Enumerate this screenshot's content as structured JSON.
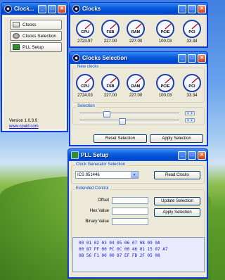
{
  "main_window": {
    "title": "Clock...",
    "buttons": [
      "Clocks",
      "Clocks Selection",
      "PLL Setup"
    ],
    "version": "Version 1.0.3.9",
    "link": "www.cpuid.com"
  },
  "clocks_window": {
    "title": "Clocks",
    "gauges": [
      {
        "label": "CPU",
        "value": "2723.97"
      },
      {
        "label": "FSB",
        "value": "227.00"
      },
      {
        "label": "RAM",
        "value": "227.00"
      },
      {
        "label": "PCIE",
        "value": "100.03"
      },
      {
        "label": "PCI",
        "value": "33.34"
      }
    ]
  },
  "selection_window": {
    "title": "Clocks Selection",
    "new_clocks_label": "New clocks",
    "gauges": [
      {
        "label": "CPU",
        "value": "2724.03"
      },
      {
        "label": "FSB",
        "value": "227.00"
      },
      {
        "label": "RAM",
        "value": "227.00"
      },
      {
        "label": "PCIE",
        "value": "100.03"
      },
      {
        "label": "PCI",
        "value": "33.34"
      }
    ],
    "selection_label": "Selection",
    "reset_button": "Reset Selection",
    "apply_button": "Apply Selection"
  },
  "pll_window": {
    "title": "PLL Setup",
    "clock_gen_label": "Clock Generator Selection",
    "clock_gen_value": "ICS 951446",
    "read_button": "Read Clocks",
    "extended_label": "Extended Control",
    "offset_label": "Offset",
    "hex_label": "Hex Value",
    "binary_label": "Binary Value",
    "update_button": "Update Selection",
    "apply_button": "Apply Selection",
    "hex_rows": [
      "00 01 02 03 04 05 06 07 08 09 0A",
      "00 87 FF 00 PC 0C 00 46 01 15 07 A7",
      "0B 56 F1 00 00 87 EF FB 2F 05 08"
    ]
  },
  "colors": {
    "title_bar": "#0a5fdc",
    "window_bg": "#ece9d8",
    "group_label": "#0046d5",
    "hex_text": "#1a1acb",
    "close_button": "#d5401b"
  },
  "icons": [
    "clock-app-icon",
    "clocks-icon",
    "clocks-selection-icon",
    "pll-icon",
    "minimize-icon",
    "maximize-icon",
    "close-icon",
    "dropdown-arrow-icon"
  ]
}
